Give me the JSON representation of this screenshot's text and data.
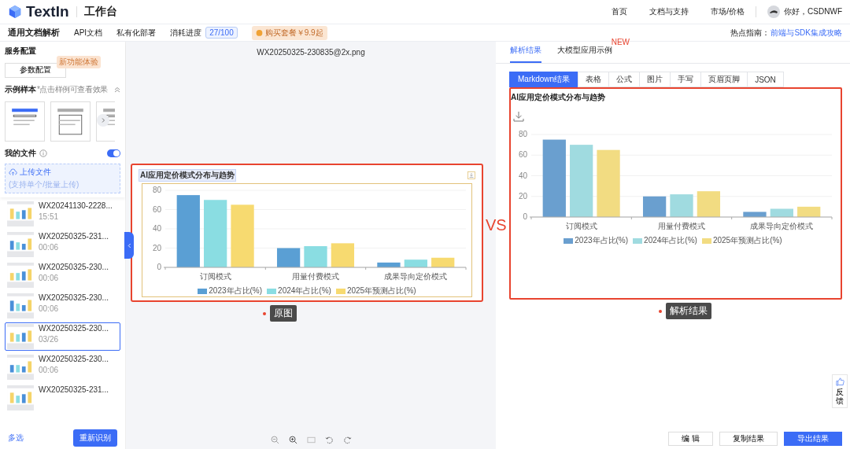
{
  "header": {
    "logo": "TextIn",
    "title": "工作台",
    "nav": [
      "首页",
      "文档与支持",
      "市场/价格"
    ],
    "user": "你好，CSDNWF"
  },
  "subnav": {
    "title": "通用文档解析",
    "links": [
      "API文档",
      "私有化部署"
    ],
    "usage_label": "消耗进度",
    "usage": "27/100",
    "promo": "购买套餐￥9.9起",
    "hot_label": "热点指南：",
    "hot_link": "前端与SDK集成攻略"
  },
  "sidebar": {
    "service_title": "服务配置",
    "config_button": "参数配置",
    "config_badge": "新功能体验",
    "samples_title": "示例样本",
    "samples_hint": "*点击样例可查看效果",
    "my_files": "我的文件",
    "my_files_toggle": {
      "on": true
    },
    "upload": "上传文件",
    "upload_hint": "(支持单个/批量上传)",
    "files": [
      {
        "name": "WX20241130-2228...",
        "time": "15:51",
        "selected": false
      },
      {
        "name": "WX20250325-231...",
        "time": "00:06",
        "selected": false
      },
      {
        "name": "WX20250325-230...",
        "time": "00:06",
        "selected": false
      },
      {
        "name": "WX20250325-230...",
        "time": "00:06",
        "selected": false
      },
      {
        "name": "WX20250325-230...",
        "time": "03/26",
        "selected": true
      },
      {
        "name": "WX20250325-230...",
        "time": "00:06",
        "selected": false
      },
      {
        "name": "WX20250325-231...",
        "selected": false
      }
    ],
    "multi_select": "多选",
    "reparse": "重新识别"
  },
  "original": {
    "filename": "WX20250325-230835@2x.png",
    "title": "AI应用定价模式分布与趋势",
    "callout": "原图",
    "chart_data": {
      "type": "bar",
      "categories": [
        "订阅模式",
        "用量付费模式",
        "成果导向定价模式"
      ],
      "series": [
        {
          "name": "2023年占比(%)",
          "color": "#5a9fd4",
          "values": [
            75,
            20,
            5
          ]
        },
        {
          "name": "2024年占比(%)",
          "color": "#8adde2",
          "values": [
            70,
            22,
            8
          ]
        },
        {
          "name": "2025年预测占比(%)",
          "color": "#f7da70",
          "values": [
            65,
            25,
            10
          ]
        }
      ],
      "ylim": [
        0,
        80
      ],
      "yticks": [
        0,
        20,
        40,
        60,
        80
      ],
      "grid": true,
      "legend": true
    }
  },
  "vs": "VS",
  "result": {
    "tabs": [
      {
        "label": "解析结果",
        "selected": true
      },
      {
        "label": "大模型应用示例",
        "selected": false,
        "badge": "NEW"
      }
    ],
    "subtabs": [
      {
        "label": "Markdown结果",
        "selected": true
      },
      {
        "label": "表格",
        "selected": false
      },
      {
        "label": "公式",
        "selected": false
      },
      {
        "label": "图片",
        "selected": false
      },
      {
        "label": "手写",
        "selected": false
      },
      {
        "label": "页眉页脚",
        "selected": false
      },
      {
        "label": "JSON",
        "selected": false
      }
    ],
    "title": "AI应用定价模式分布与趋势",
    "callout": "解析结果",
    "chart_data": {
      "type": "bar",
      "categories": [
        "订阅模式",
        "用量付费模式",
        "成果导向定价模式"
      ],
      "series": [
        {
          "name": "2023年占比(%)",
          "color": "#6a9fcf",
          "values": [
            75,
            20,
            5
          ]
        },
        {
          "name": "2024年占比(%)",
          "color": "#a0dbe0",
          "values": [
            70,
            22,
            8
          ]
        },
        {
          "name": "2025年预测占比(%)",
          "color": "#f2dc82",
          "values": [
            65,
            25,
            10
          ]
        }
      ],
      "ylim": [
        0,
        80
      ],
      "yticks": [
        0,
        20,
        40,
        60,
        80
      ],
      "grid": true,
      "legend": true
    },
    "feedback": "反馈",
    "buttons": [
      "编 辑",
      "复制结果",
      "导出结果"
    ]
  }
}
